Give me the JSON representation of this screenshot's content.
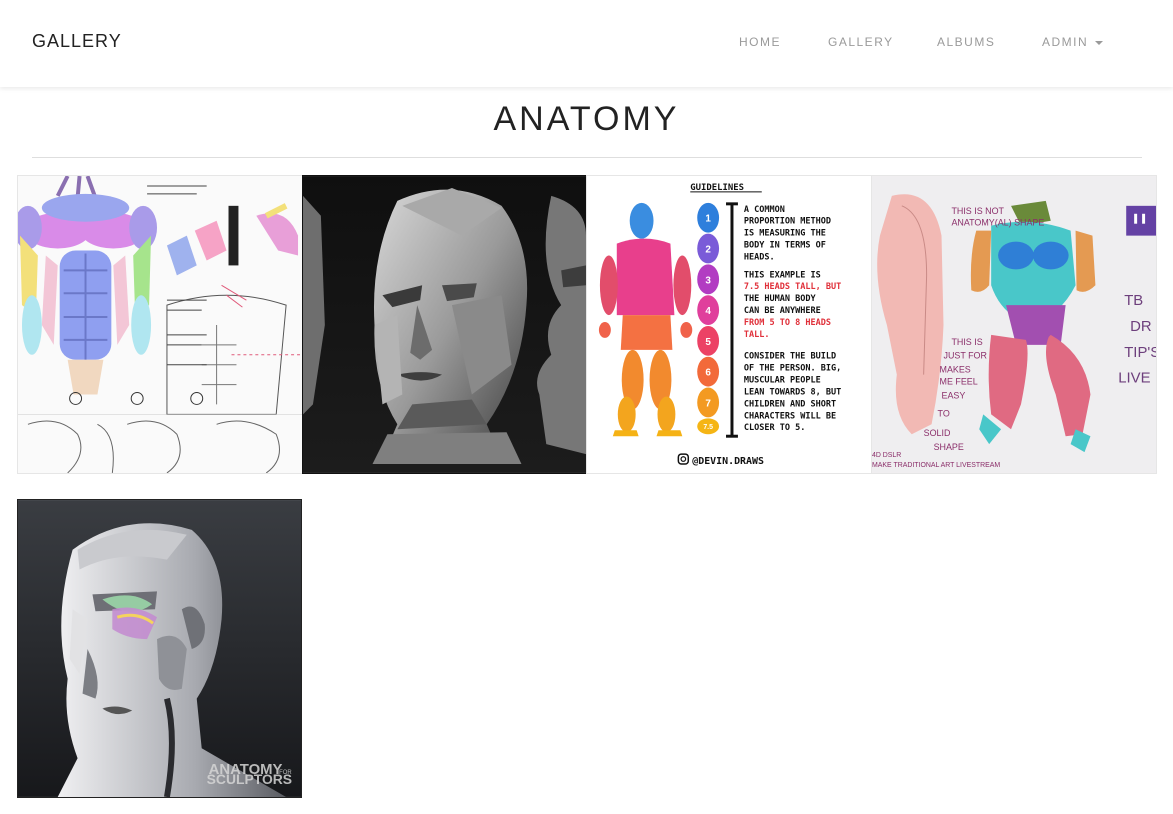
{
  "nav": {
    "brand": "GALLERY",
    "links": [
      "HOME",
      "GALLERY",
      "ALBUMS",
      "ADMIN"
    ]
  },
  "page": {
    "title": "ANATOMY"
  },
  "images": {
    "guidelines": {
      "heading": "GUIDELINES",
      "lines": [
        "A COMMON",
        "PROPORTION METHOD",
        "IS MEASURING THE",
        "BODY IN TERMS OF",
        "HEADS.",
        "THIS EXAMPLE IS",
        "7.5 HEADS TALL, BUT",
        "THE HUMAN BODY",
        "CAN BE ANYWHERE",
        "FROM 5 TO 8 HEADS",
        "TALL.",
        "CONSIDER THE BUILD",
        "OF THE PERSON. BIG,",
        "MUSCULAR PEOPLE",
        "LEAN TOWARDS 8, BUT",
        "CHILDREN AND SHORT",
        "CHARACTERS WILL BE",
        "CLOSER TO 5."
      ],
      "numbers": [
        "1",
        "2",
        "3",
        "4",
        "5",
        "6",
        "7",
        "7.5"
      ],
      "handle": "@DEVIN.DRAWS"
    },
    "shape": {
      "note1": "THIS IS NOT",
      "note2": "ANATOMY(AL) SHAPE",
      "note3": "THIS IS",
      "note4": "JUST FOR",
      "note5": "MAKES",
      "note6": "ME FEEL",
      "note7": "EASY",
      "note8": "TO",
      "note9": "SOLID",
      "note10": "SHAPE",
      "side1": "TB",
      "side2": "DR",
      "side3": "TIP'S",
      "side4": "LIVE",
      "footer1": "4D DSLR",
      "footer2": "MAKE TRADITIONAL ART LIVESTREAM"
    },
    "sculptors": {
      "watermark1": "ANATOMY",
      "watermark2": "FOR",
      "watermark3": "SCULPTORS"
    }
  }
}
